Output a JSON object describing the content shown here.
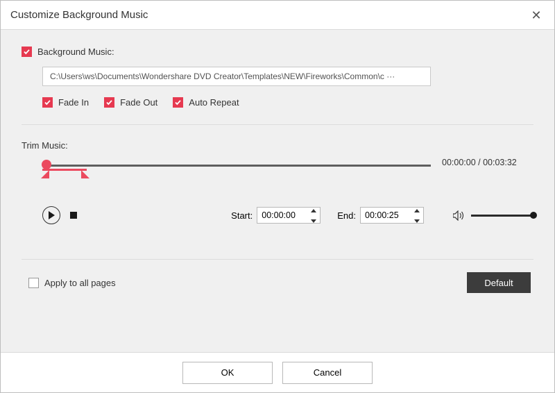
{
  "window": {
    "title": "Customize Background Music"
  },
  "bgm": {
    "label": "Background Music:",
    "path": "C:\\Users\\ws\\Documents\\Wondershare DVD Creator\\Templates\\NEW\\Fireworks\\Common\\c ···",
    "options": {
      "fade_in": "Fade In",
      "fade_out": "Fade Out",
      "auto_repeat": "Auto Repeat"
    }
  },
  "trim": {
    "label": "Trim Music:",
    "time_display": "00:00:00 / 00:03:32",
    "start_label": "Start:",
    "start_value": "00:00:00",
    "end_label": "End:",
    "end_value": "00:00:25"
  },
  "footer": {
    "apply_all": "Apply to all pages",
    "default": "Default"
  },
  "buttons": {
    "ok": "OK",
    "cancel": "Cancel"
  },
  "accent": "#e63950"
}
